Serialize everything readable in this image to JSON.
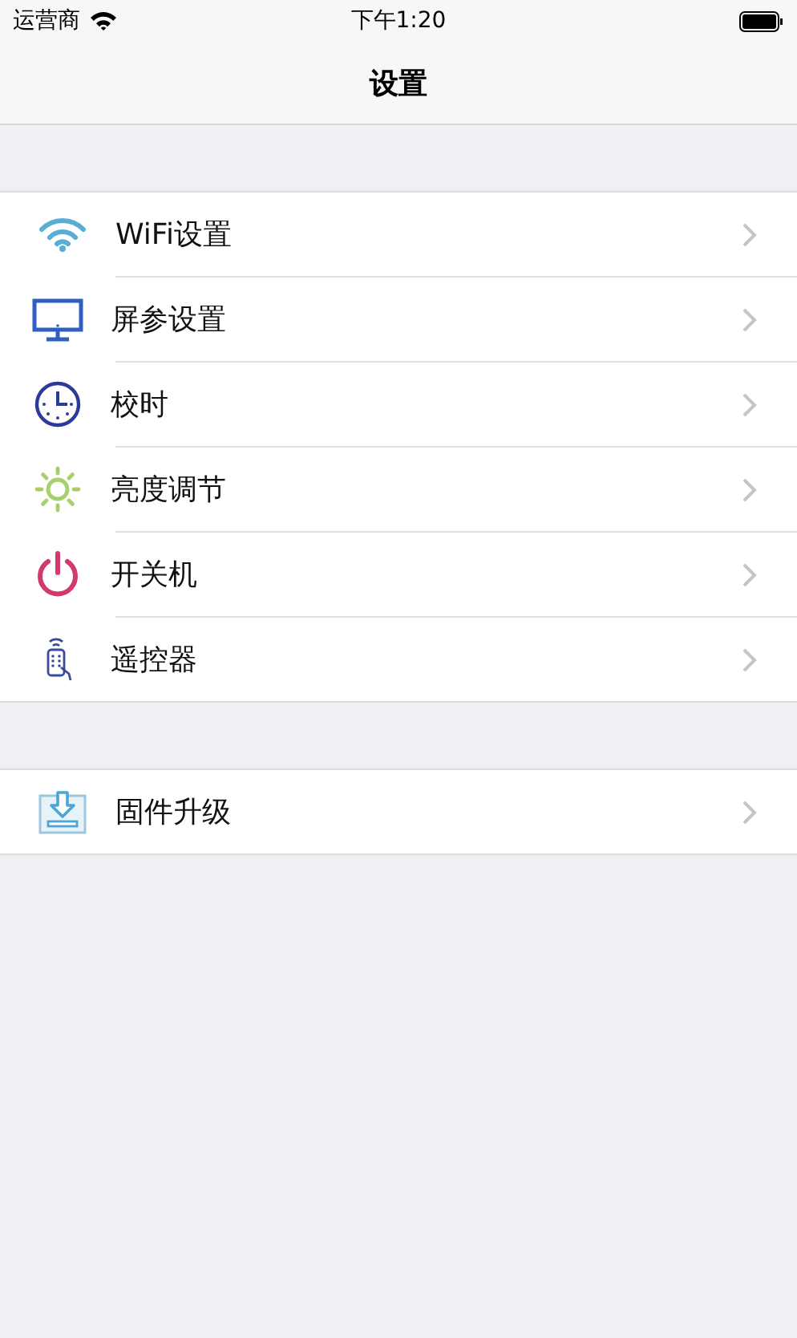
{
  "status_bar": {
    "carrier": "运营商",
    "time": "下午1:20"
  },
  "nav_bar": {
    "title": "设置"
  },
  "sections": [
    {
      "items": [
        {
          "label": "WiFi设置"
        },
        {
          "label": "屏参设置"
        },
        {
          "label": "校时"
        },
        {
          "label": "亮度调节"
        },
        {
          "label": "开关机"
        },
        {
          "label": "遥控器"
        }
      ]
    },
    {
      "items": [
        {
          "label": "固件升级"
        }
      ]
    }
  ]
}
